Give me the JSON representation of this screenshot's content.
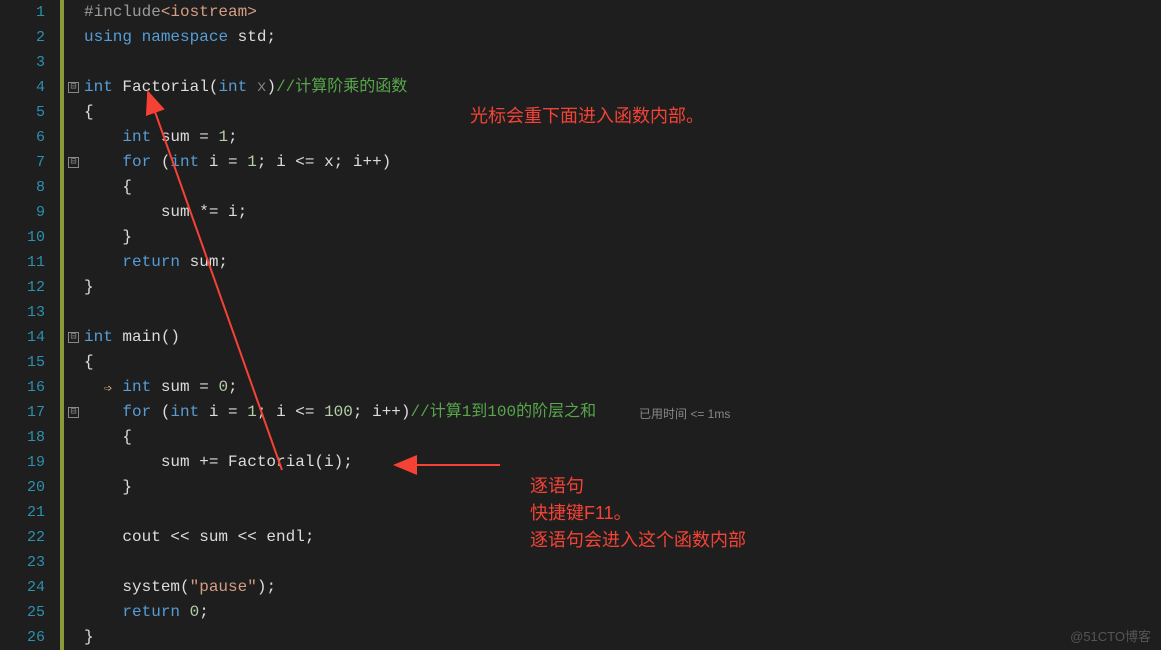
{
  "lines": {
    "l1": {
      "num": "1"
    },
    "l2": {
      "num": "2"
    },
    "l3": {
      "num": "3"
    },
    "l4": {
      "num": "4"
    },
    "l5": {
      "num": "5"
    },
    "l6": {
      "num": "6"
    },
    "l7": {
      "num": "7"
    },
    "l8": {
      "num": "8"
    },
    "l9": {
      "num": "9"
    },
    "l10": {
      "num": "10"
    },
    "l11": {
      "num": "11"
    },
    "l12": {
      "num": "12"
    },
    "l13": {
      "num": "13"
    },
    "l14": {
      "num": "14"
    },
    "l15": {
      "num": "15"
    },
    "l16": {
      "num": "16"
    },
    "l17": {
      "num": "17"
    },
    "l18": {
      "num": "18"
    },
    "l19": {
      "num": "19"
    },
    "l20": {
      "num": "20"
    },
    "l21": {
      "num": "21"
    },
    "l22": {
      "num": "22"
    },
    "l23": {
      "num": "23"
    },
    "l24": {
      "num": "24"
    },
    "l25": {
      "num": "25"
    },
    "l26": {
      "num": "26"
    }
  },
  "code": {
    "l1_include": "#include",
    "l1_file": "<iostream>",
    "l2_using": "using",
    "l2_ns": "namespace",
    "l2_std": "std",
    "l2_semi": ";",
    "l4_int": "int",
    "l4_func": " Factorial",
    "l4_open": "(",
    "l4_ptype": "int",
    "l4_param": " x",
    "l4_close": ")",
    "l4_comment": "//计算阶乘的函数",
    "l5_brace": "{",
    "l6_int": "int",
    "l6_rest": " sum = ",
    "l6_num": "1",
    "l6_semi": ";",
    "l7_for": "for",
    "l7_open": " (",
    "l7_int": "int",
    "l7_init": " i = ",
    "l7_num1": "1",
    "l7_cond": "; i <= x; i++)",
    "l8_brace": "{",
    "l9_body": "sum *= i;",
    "l10_brace": "}",
    "l11_return": "return",
    "l11_val": " sum;",
    "l12_brace": "}",
    "l14_int": "int",
    "l14_main": " main()",
    "l15_brace": "{",
    "l16_int": "int",
    "l16_rest": " sum = ",
    "l16_num": "0",
    "l16_semi": ";",
    "l17_for": "for",
    "l17_open": " (",
    "l17_int": "int",
    "l17_init": " i = ",
    "l17_num1": "1",
    "l17_cond1": "; i <= ",
    "l17_num2": "100",
    "l17_cond2": "; i++)",
    "l17_comment": "//计算1到100的阶层之和",
    "l18_brace": "{",
    "l19_body": "sum += Factorial(i);",
    "l20_brace": "}",
    "l22_cout": "cout << sum << endl;",
    "l24_sys": "system(",
    "l24_str": "\"pause\"",
    "l24_close": ");",
    "l25_return": "return",
    "l25_val": " ",
    "l25_num": "0",
    "l25_semi": ";",
    "l26_brace": "}"
  },
  "annotations": {
    "top": "光标会重下面进入函数内部。",
    "bottom1": "逐语句",
    "bottom2": "快捷键F11。",
    "bottom3": "逐语句会进入这个函数内部"
  },
  "timing": "已用时间 <= 1ms",
  "watermark": "@51CTO博客",
  "fold": {
    "minus": "⊟"
  },
  "exec_arrow": "➩"
}
